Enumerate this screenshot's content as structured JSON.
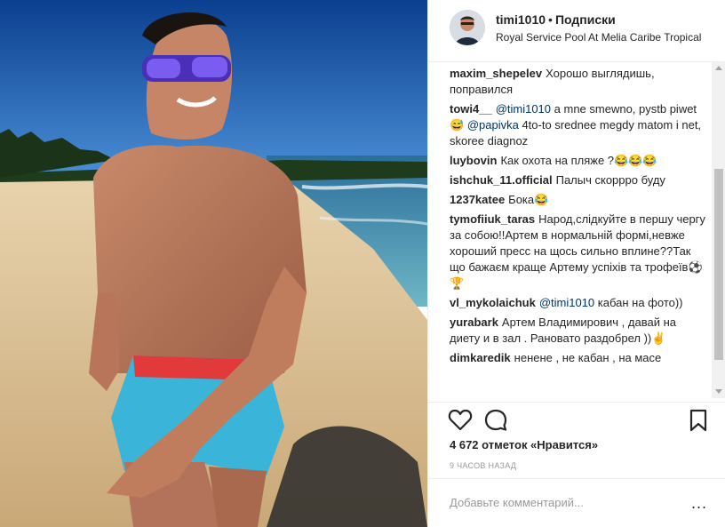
{
  "post": {
    "username": "timi1010",
    "separator": "•",
    "follow_label": "Подписки",
    "location": "Royal Service Pool At Melia Caribe Tropical"
  },
  "comments": [
    {
      "user": "maxim_shepelev",
      "parts": [
        {
          "t": "Хорошо выглядишь, поправился"
        }
      ]
    },
    {
      "user": "towi4__",
      "parts": [
        {
          "t": "@timi1010",
          "m": true
        },
        {
          "t": " a mne smewno, pystb piwet😅 "
        },
        {
          "t": "@papivka",
          "m": true
        },
        {
          "t": " 4to-to srednee megdy matom i net, skoree diagnoz"
        }
      ]
    },
    {
      "user": "luybovin",
      "parts": [
        {
          "t": "Как охота на пляже ?😂😂😂"
        }
      ]
    },
    {
      "user": "ishchuk_11.official",
      "parts": [
        {
          "t": "Палыч скоррро буду"
        }
      ]
    },
    {
      "user": "1237katee",
      "parts": [
        {
          "t": "Бока😂"
        }
      ]
    },
    {
      "user": "tymofiiuk_taras",
      "parts": [
        {
          "t": "Народ,слідкуйте в першу чергу за собою!!Артем в нормальній формі,невже хороший пресс на щось сильно вплине??Так що бажаєм краще Артему успіхів та трофеїв⚽🏆"
        }
      ]
    },
    {
      "user": "vl_mykolaichuk",
      "parts": [
        {
          "t": "@timi1010",
          "m": true
        },
        {
          "t": " кабан на фото))"
        }
      ]
    },
    {
      "user": "yurabark",
      "parts": [
        {
          "t": "Артем Владимирович , давай на диету и в зал . Рановато раздобрел ))✌"
        }
      ]
    },
    {
      "user": "dimkaredik",
      "parts": [
        {
          "t": "ненене , не кабан , на масе"
        }
      ]
    }
  ],
  "actions": {
    "like_icon": "heart-icon",
    "comment_icon": "comment-icon",
    "save_icon": "bookmark-icon"
  },
  "likes_text": "4 672 отметок «Нравится»",
  "time_text": "9 ЧАСОВ НАЗАД",
  "add_comment": {
    "placeholder": "Добавьте комментарий...",
    "more_label": "..."
  },
  "colors": {
    "mention": "#003569",
    "sky": "#1f5fb0",
    "sand": "#dcc39b"
  }
}
